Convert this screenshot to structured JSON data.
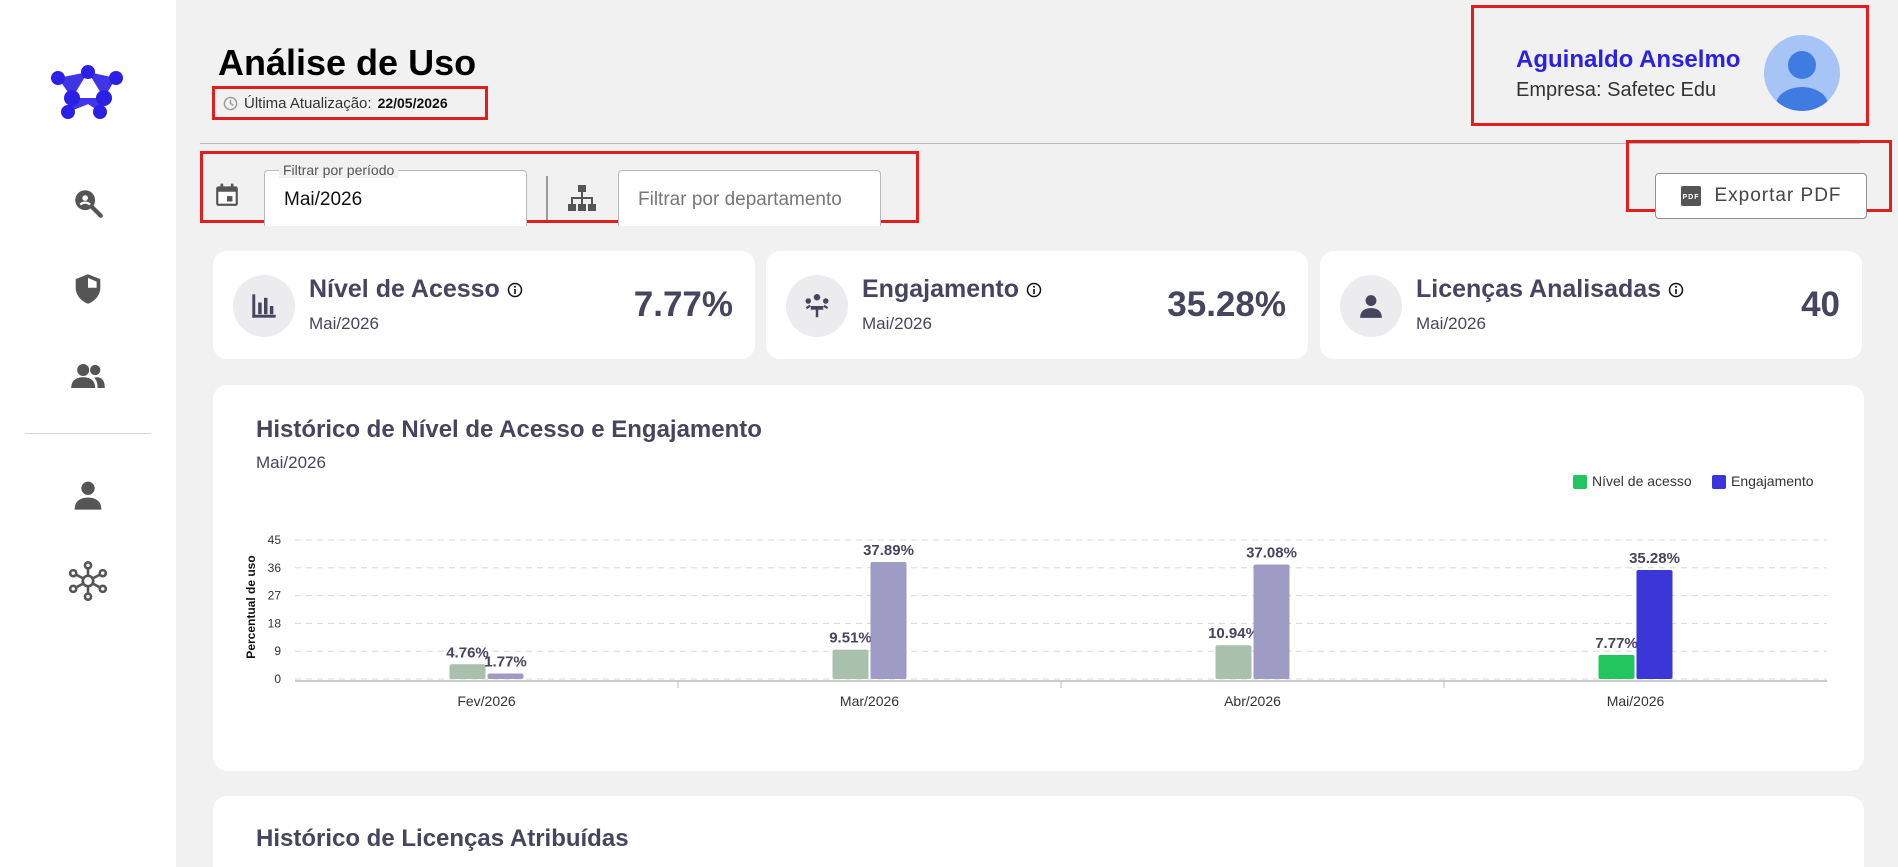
{
  "header": {
    "title": "Análise de Uso",
    "last_update_label": "Última Atualização:",
    "last_update_date": "22/05/2026"
  },
  "user": {
    "name": "Aguinaldo Anselmo",
    "company": "Empresa: Safetec Edu"
  },
  "filters": {
    "period_label": "Filtrar por período",
    "period_value": "Mai/2026",
    "department_placeholder": "Filtrar por departamento"
  },
  "export": {
    "label": "Exportar PDF"
  },
  "sidebar": {
    "items": [
      {
        "icon": "search-analytics-icon"
      },
      {
        "icon": "shield-icon"
      },
      {
        "icon": "users-icon"
      },
      {
        "icon": "person-icon"
      },
      {
        "icon": "network-icon"
      }
    ]
  },
  "cards": [
    {
      "title": "Nível de Acesso",
      "period": "Mai/2026",
      "value": "7.77%",
      "icon": "bar-chart-icon"
    },
    {
      "title": "Engajamento",
      "period": "Mai/2026",
      "value": "35.28%",
      "icon": "engagement-icon"
    },
    {
      "title": "Licenças Analisadas",
      "period": "Mai/2026",
      "value": "40",
      "icon": "person-icon"
    }
  ],
  "history_panel": {
    "title": "Histórico de Nível de Acesso e Engajamento",
    "period": "Mai/2026"
  },
  "licenses_panel": {
    "title": "Histórico de Licenças Atribuídas"
  },
  "colors": {
    "access": "#22c55e",
    "engagement": "#3b36d8",
    "access_faded": "#a9c1ac",
    "engagement_faded": "#9e9bc4",
    "highlight_border": "#e11d1d",
    "user_name": "#2b20e6"
  },
  "chart_data": {
    "type": "bar",
    "title": "",
    "xlabel": "",
    "ylabel": "Percentual de uso",
    "ylim": [
      0,
      45
    ],
    "yticks": [
      0,
      9,
      18,
      27,
      36,
      45
    ],
    "categories": [
      "Fev/2026",
      "Mar/2026",
      "Abr/2026",
      "Mai/2026"
    ],
    "series": [
      {
        "name": "Nível de acesso",
        "values": [
          4.76,
          9.51,
          10.94,
          7.77
        ],
        "labels": [
          "4.76%",
          "9.51%",
          "10.94%",
          "7.77%"
        ]
      },
      {
        "name": "Engajamento",
        "values": [
          1.77,
          37.89,
          37.08,
          35.28
        ],
        "labels": [
          "1.77%",
          "37.89%",
          "37.08%",
          "35.28%"
        ]
      }
    ],
    "highlight_category": "Mai/2026",
    "grid": true,
    "legend": "top-right"
  }
}
